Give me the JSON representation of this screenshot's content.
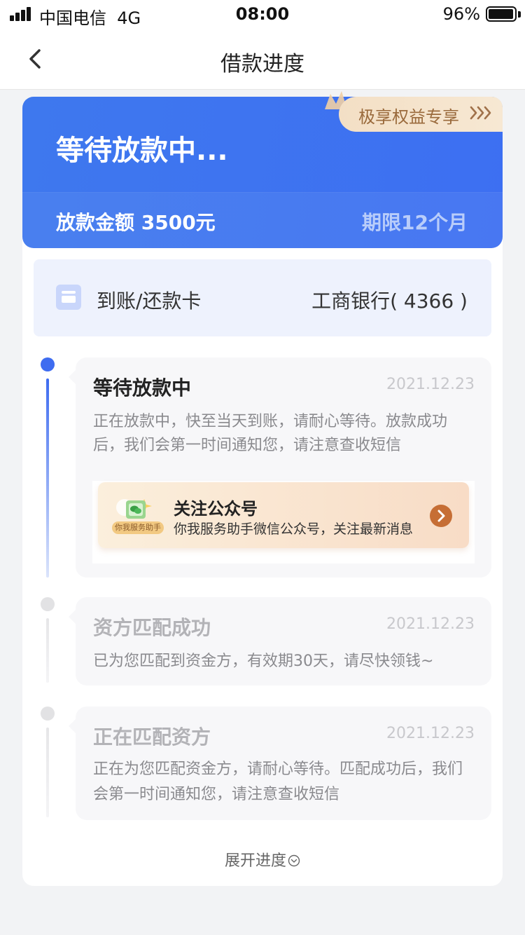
{
  "status_bar": {
    "carrier": "中国电信",
    "network": "4G",
    "time": "08:00",
    "battery": "96%",
    "battery_level": 0.96
  },
  "nav": {
    "title": "借款进度",
    "back_icon": "chevron-left-icon"
  },
  "hero": {
    "status_title": "等待放款中...",
    "amount_label": "放款金额 3500元",
    "term_label": "期限12个月",
    "perk_label": "极享权益专享"
  },
  "card": {
    "label": "到账/还款卡",
    "value": "工商银行( 4366 )"
  },
  "steps": [
    {
      "title": "等待放款中",
      "date": "2021.12.23",
      "desc_lines": [
        "正在放款中，快至当天到账，请耐心等待。放款成功",
        "后，我们会第一时间通知您，请注意查收短信"
      ],
      "active": true
    },
    {
      "title": "资方匹配成功",
      "date": "2021.12.23",
      "desc_lines": [
        "已为您匹配到资金方，有效期30天，请尽快领钱~"
      ],
      "active": false
    },
    {
      "title": "正在匹配资方",
      "date": "2021.12.23",
      "desc_lines": [
        "正在为您匹配资金方，请耐心等待。匹配成功后，我们",
        "会第一时间通知您，请注意查收短信"
      ],
      "active": false
    }
  ],
  "follow": {
    "tag": "你我服务助手",
    "title": "关注公众号",
    "subtitle": "你我服务助手微信公众号，关注最新消息"
  },
  "expand_label": "展开进度",
  "colors": {
    "accent": "#3e78ee",
    "background": "#f2f3f5",
    "perk_text": "#9a6a3c",
    "follow_arrow": "#c66e35"
  }
}
